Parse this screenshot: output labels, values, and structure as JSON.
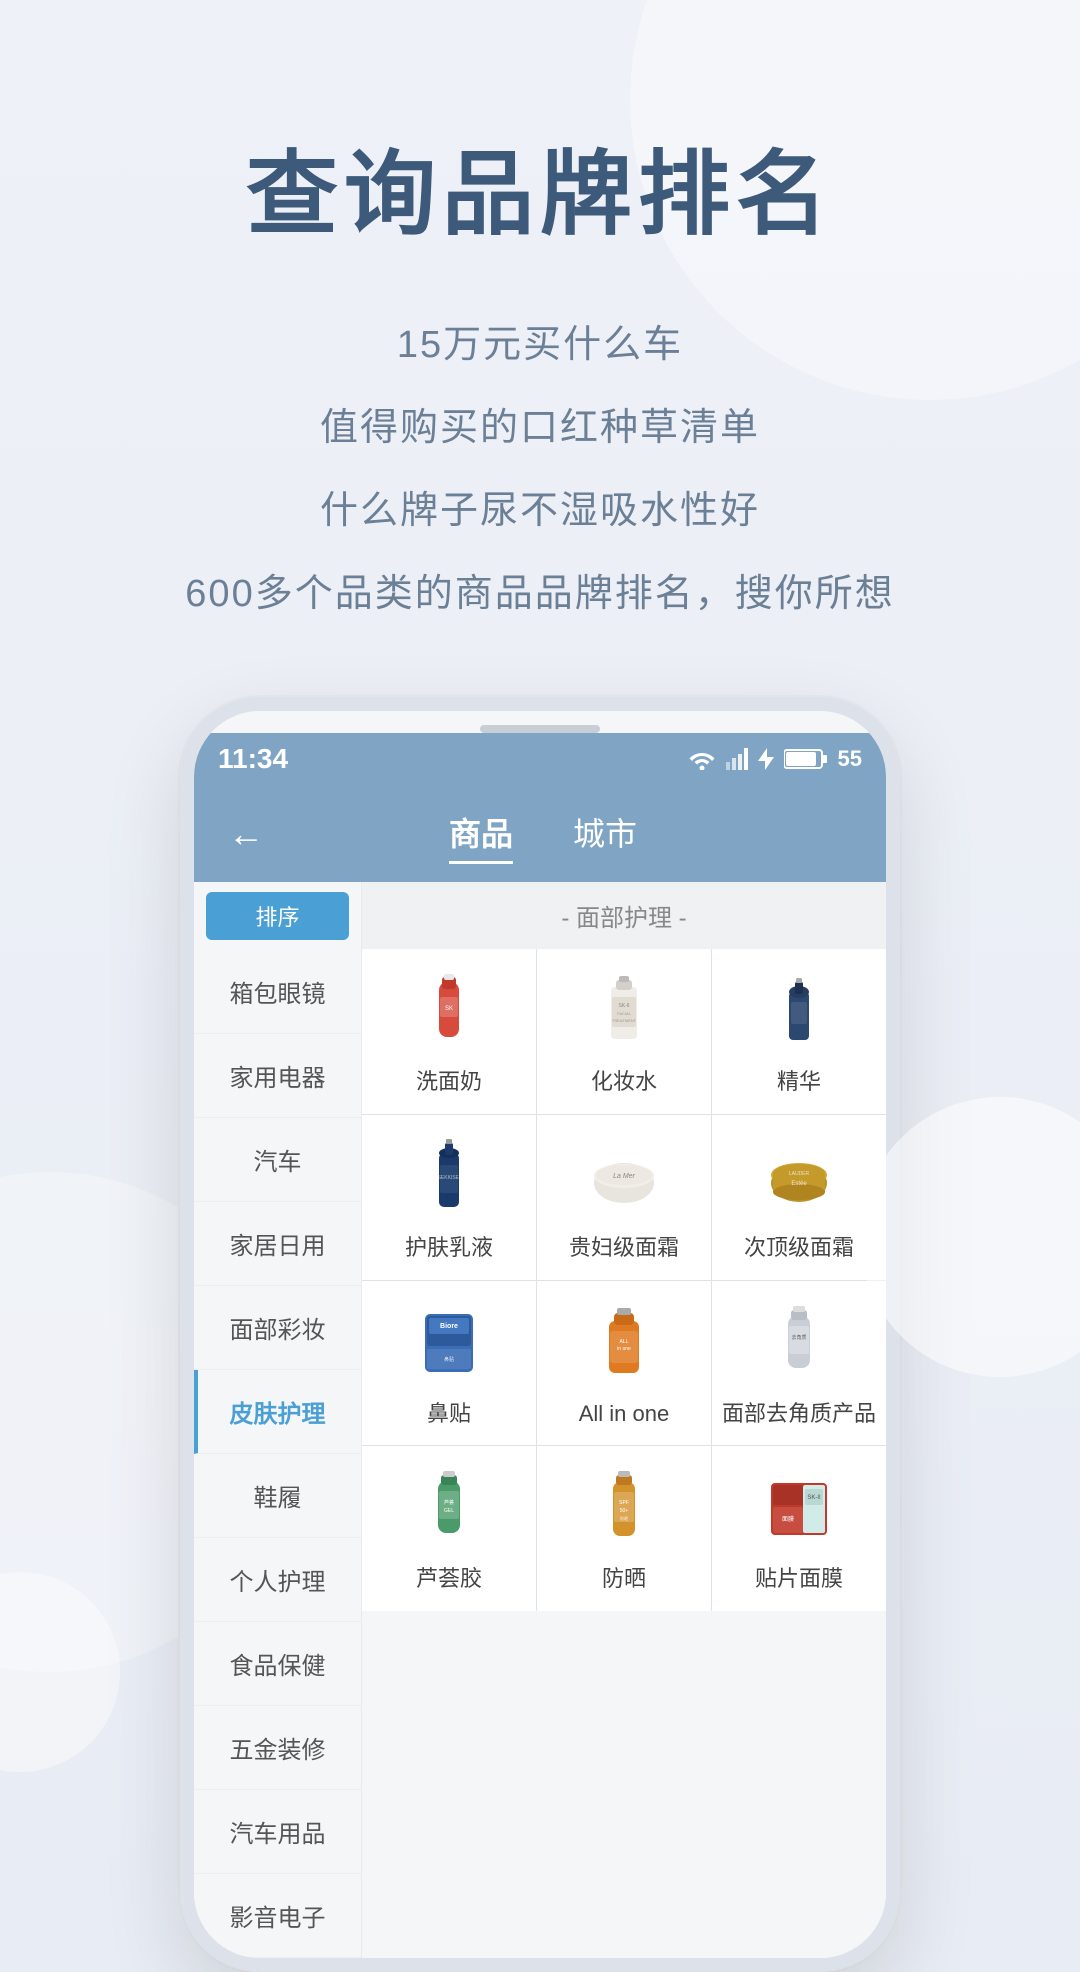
{
  "page": {
    "bg_color": "#eef1f7"
  },
  "header": {
    "main_title": "查询品牌排名",
    "subtitles": [
      "15万元买什么车",
      "值得购买的口红种草清单",
      "什么牌子尿不湿吸水性好",
      "600多个品类的商品品牌排名，搜你所想"
    ]
  },
  "phone": {
    "status_bar": {
      "time": "11:34",
      "battery": "55"
    },
    "nav": {
      "back_label": "←",
      "tabs": [
        {
          "label": "商品",
          "active": true
        },
        {
          "label": "城市",
          "active": false
        }
      ]
    },
    "sidebar": {
      "items": [
        {
          "label": "排序",
          "type": "highlight"
        },
        {
          "label": "箱包眼镜",
          "active": false
        },
        {
          "label": "家用电器",
          "active": false
        },
        {
          "label": "汽车",
          "active": false
        },
        {
          "label": "家居日用",
          "active": false
        },
        {
          "label": "面部彩妆",
          "active": false
        },
        {
          "label": "皮肤护理",
          "active": true
        },
        {
          "label": "鞋履",
          "active": false
        },
        {
          "label": "个人护理",
          "active": false
        },
        {
          "label": "食品保健",
          "active": false
        },
        {
          "label": "五金装修",
          "active": false
        },
        {
          "label": "汽车用品",
          "active": false
        },
        {
          "label": "影音电子",
          "active": false
        }
      ]
    },
    "product_grid": {
      "category_header": "- 面部护理 -",
      "rows": [
        [
          {
            "label": "洗面奶",
            "icon": "cleanser-icon"
          },
          {
            "label": "化妆水",
            "icon": "toner-icon"
          },
          {
            "label": "精华",
            "icon": "serum-icon"
          }
        ],
        [
          {
            "label": "护肤乳液",
            "icon": "lotion-icon"
          },
          {
            "label": "贵妇级面霜",
            "icon": "lamer-icon"
          },
          {
            "label": "次顶级面霜",
            "icon": "cream-icon"
          }
        ],
        [
          {
            "label": "鼻贴",
            "icon": "nosepatch-icon"
          },
          {
            "label": "All in one",
            "icon": "allinone-icon"
          },
          {
            "label": "面部去角质产品",
            "icon": "exfoliant-icon"
          }
        ],
        [
          {
            "label": "芦荟胶",
            "icon": "aloegel-icon"
          },
          {
            "label": "防晒",
            "icon": "sunscreen-icon"
          },
          {
            "label": "贴片面膜",
            "icon": "sheetmask-icon"
          }
        ]
      ]
    }
  }
}
